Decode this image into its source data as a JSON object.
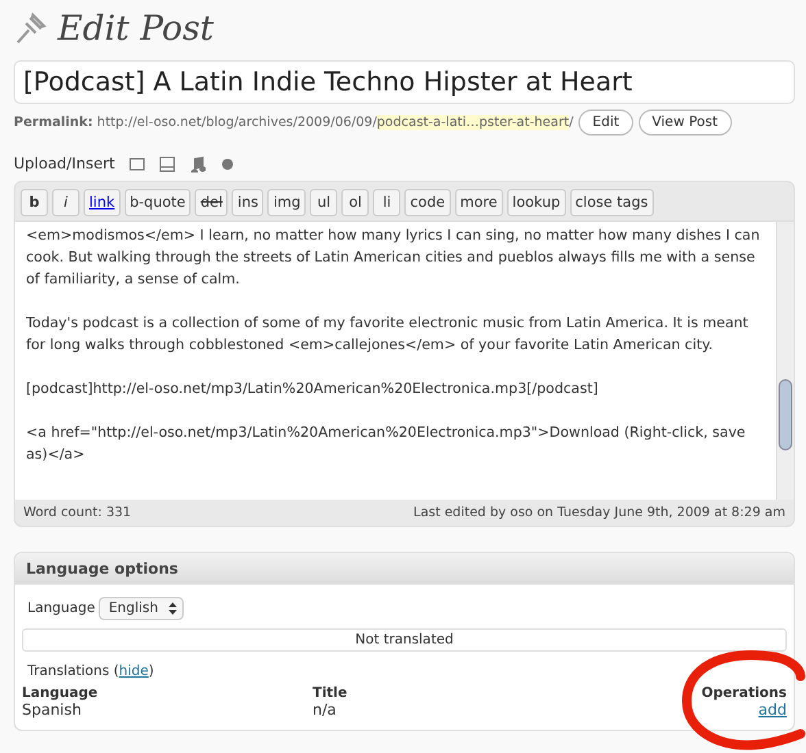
{
  "heading": "Edit Post",
  "title_field": {
    "value": "[Podcast] A Latin Indie Techno Hipster at Heart"
  },
  "permalink": {
    "label": "Permalink:",
    "base": "http://el-oso.net/blog/archives/2009/06/09/",
    "slug": "podcast-a-lati…pster-at-heart",
    "trail": "/",
    "buttons": [
      "Edit",
      "View Post"
    ]
  },
  "upload": {
    "label": "Upload/Insert",
    "icons": [
      {
        "kind": "image"
      },
      {
        "kind": "video"
      },
      {
        "kind": "audio"
      },
      {
        "kind": "media"
      }
    ]
  },
  "toolbar": [
    {
      "label": "b",
      "kind": "bold"
    },
    {
      "label": "i",
      "kind": "italic"
    },
    {
      "label": "link",
      "kind": "link"
    },
    {
      "label": "b-quote",
      "kind": "plain"
    },
    {
      "label": "del",
      "kind": "strike"
    },
    {
      "label": "ins",
      "kind": "plain"
    },
    {
      "label": "img",
      "kind": "plain"
    },
    {
      "label": "ul",
      "kind": "plain"
    },
    {
      "label": "ol",
      "kind": "plain"
    },
    {
      "label": "li",
      "kind": "plain"
    },
    {
      "label": "code",
      "kind": "plain"
    },
    {
      "label": "more",
      "kind": "plain"
    },
    {
      "label": "lookup",
      "kind": "plain"
    },
    {
      "label": "close tags",
      "kind": "plain"
    }
  ],
  "editor_paragraphs": [
    "<em>modismos</em> I learn, no matter how many lyrics I can sing, no matter how many dishes I can cook. But walking through the streets of Latin American cities and pueblos always fills me with a sense of familiarity, a sense of calm.",
    "Today's podcast is a collection of some of my favorite electronic music from Latin America. It is meant for long walks through cobblestoned <em>callejones</em> of your favorite Latin American city.",
    "[podcast]http://el-oso.net/mp3/Latin%20American%20Electronica.mp3[/podcast]",
    "<a href=\"http://el-oso.net/mp3/Latin%20American%20Electronica.mp3\">Download (Right-click, save as)</a>"
  ],
  "status": {
    "word_count": "Word count: 331",
    "last_edited": "Last edited by oso on Tuesday June 9th, 2009 at 8:29 am"
  },
  "language_panel": {
    "title": "Language options",
    "language_label": "Language",
    "language_value": "English",
    "translation_status": "Not translated",
    "translations_label": "Translations (",
    "hide_link": "hide",
    "translations_close": ")",
    "columns": [
      "Language",
      "Title",
      "Operations"
    ],
    "row": {
      "language": "Spanish",
      "title": "n/a",
      "operation": "add"
    }
  },
  "annotation": {
    "kind": "circle"
  }
}
